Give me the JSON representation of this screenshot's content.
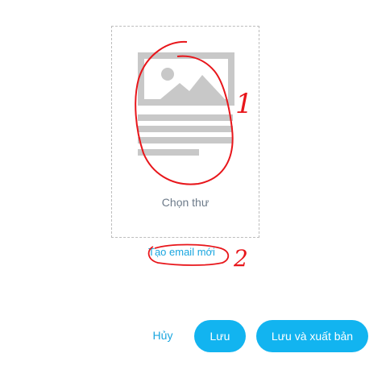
{
  "picker": {
    "choose_label": "Chọn thư"
  },
  "create_link": "Tạo email mới",
  "annotations": {
    "marker_one": "1",
    "marker_two": "2",
    "color": "#e8161b"
  },
  "actions": {
    "cancel_label": "Hủy",
    "save_label": "Lưu",
    "save_publish_label": "Lưu và xuất bản"
  },
  "colors": {
    "accent": "#12b4f0",
    "link": "#1aa6df",
    "placeholder_gray": "#c8c8c8",
    "label_gray": "#6d7b8a"
  },
  "icons": [
    "image-placeholder-icon",
    "text-lines-icon"
  ]
}
